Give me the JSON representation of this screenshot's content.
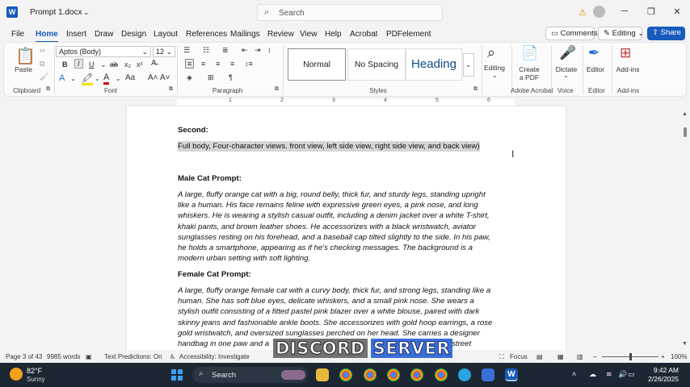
{
  "titlebar": {
    "app_icon": "word-icon",
    "document_name": "Prompt 1.docx",
    "search_placeholder": "Search",
    "warning_icon": "warning-icon",
    "minimize": "─",
    "restore": "❐",
    "close": "✕"
  },
  "menu": {
    "tabs": [
      "File",
      "Home",
      "Insert",
      "Draw",
      "Design",
      "Layout",
      "References",
      "Mailings",
      "Review",
      "View",
      "Help",
      "Acrobat",
      "PDFelement"
    ],
    "active_tab": "Home",
    "comments_label": "Comments",
    "editing_label": "Editing",
    "share_label": "Share"
  },
  "ribbon": {
    "clipboard": {
      "paste_label": "Paste",
      "group_label": "Clipboard"
    },
    "font": {
      "font_name": "Aptos (Body)",
      "font_size": "12",
      "group_label": "Font"
    },
    "paragraph": {
      "group_label": "Paragraph"
    },
    "styles": {
      "items": [
        "Normal",
        "No Spacing",
        "Heading"
      ],
      "selected": "Normal",
      "group_label": "Styles"
    },
    "editing": {
      "label": "Editing"
    },
    "acrobat": {
      "label_line1": "Create",
      "label_line2": "a PDF",
      "group_label": "Adobe Acrobat"
    },
    "voice": {
      "label": "Dictate",
      "group_label": "Voice"
    },
    "editor": {
      "label": "Editor",
      "group_label": "Editor"
    },
    "addins": {
      "label": "Add-ins",
      "group_label": "Add-ins"
    }
  },
  "ruler": {
    "numbers": [
      "1",
      "2",
      "3",
      "4",
      "5",
      "6"
    ]
  },
  "document": {
    "second_heading": "Second",
    "selected_line": "Full body, Four-character views. front view, left side view, right side view, and back view)",
    "male_heading": "Male Cat Prompt:",
    "male_lines": [
      "A large, fluffy orange cat with a big, round belly, thick fur, and sturdy legs, standing upright",
      "like a human. His face remains feline with expressive green eyes, a pink nose, and long",
      "whiskers. He is wearing a stylish casual outfit, including a denim jacket over a white T-shirt,",
      "khaki pants, and brown leather shoes. He accessorizes with a black wristwatch, aviator",
      "sunglasses resting on his forehead, and a baseball cap tilted slightly to the side. In his paw,",
      "he holds a smartphone, appearing as if he's checking messages. The background is a",
      "modern urban setting with soft lighting."
    ],
    "female_heading": "Female Cat Prompt:",
    "female_lines": [
      "A large, fluffy orange female cat with a curvy body, thick fur, and strong legs, standing like a",
      "human. She has soft blue eyes, delicate whiskers, and a small pink nose. She wears a",
      "stylish outfit consisting of a fitted pastel pink blazer over a white blouse, paired with dark",
      "skinny jeans and fashionable ankle boots. She accessorizes with gold hoop earrings, a rose",
      "gold wristwatch, and oversized sunglasses perched on her head. She carries a designer",
      "handbag in one paw and a                                                        ckground is a city street"
    ]
  },
  "status": {
    "page": "Page 3 of 43",
    "words": "9985 words",
    "text_predictions": "Text Predictions: On",
    "accessibility": "Accessibility: Investigate",
    "focus": "Focus",
    "zoom": "100%"
  },
  "overlay": {
    "word1": "DISCORD",
    "word2": "SERVER"
  },
  "taskbar": {
    "temperature": "82°F",
    "condition": "Sunny",
    "search_placeholder": "Search",
    "time": "9:42 AM",
    "date": "2/26/2025"
  }
}
